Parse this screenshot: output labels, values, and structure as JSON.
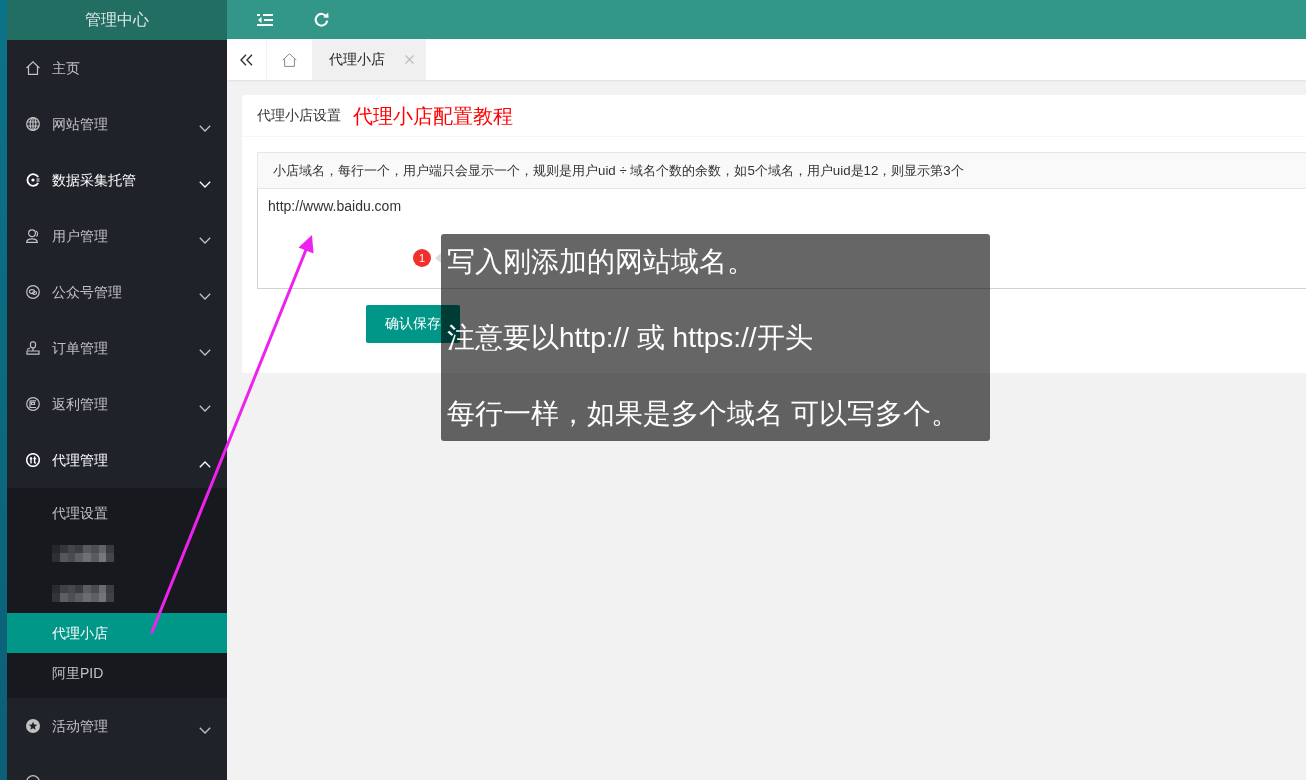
{
  "sidebar": {
    "title": "管理中心",
    "items": [
      {
        "kind": "link",
        "label": "主页",
        "hover": false
      },
      {
        "kind": "group",
        "label": "网站管理",
        "hover": false,
        "expanded": false
      },
      {
        "kind": "group",
        "label": "数据采集托管",
        "hover": true,
        "expanded": false
      },
      {
        "kind": "group",
        "label": "用户管理",
        "hover": false,
        "expanded": false
      },
      {
        "kind": "group",
        "label": "公众号管理",
        "hover": false,
        "expanded": false
      },
      {
        "kind": "group",
        "label": "订单管理",
        "hover": false,
        "expanded": false
      },
      {
        "kind": "group",
        "label": "返利管理",
        "hover": false,
        "expanded": false
      },
      {
        "kind": "group",
        "label": "代理管理",
        "hover": false,
        "expanded": true,
        "children": [
          {
            "kind": "item",
            "label": "代理设置",
            "selected": false
          },
          {
            "kind": "redacted",
            "selected": false
          },
          {
            "kind": "redacted",
            "selected": false
          },
          {
            "kind": "item",
            "label": "代理小店",
            "selected": true
          },
          {
            "kind": "item",
            "label": "阿里PID",
            "selected": false
          }
        ]
      },
      {
        "kind": "group",
        "label": "活动管理",
        "hover": false,
        "expanded": false
      },
      {
        "kind": "partial"
      }
    ]
  },
  "tabs": [
    {
      "kind": "home",
      "selected": false
    },
    {
      "kind": "page",
      "label": "代理小店",
      "selected": true
    }
  ],
  "panel": {
    "title": "代理小店设置",
    "tutorial_link": "代理小店配置教程",
    "notice": "小店域名，每行一个，用户端只会显示一个，规则是用户uid ÷ 域名个数的余数，如5个域名，用户uid是12，则显示第3个",
    "domains_field": {
      "value": "http://www.baidu.com"
    },
    "save_button": "确认保存"
  },
  "guide_tooltip": {
    "step": "1",
    "lines": [
      "写入刚添加的网站域名。",
      "注意要以http:// 或 https://开头",
      "每行一样，如果是多个域名 可以写多个。"
    ]
  }
}
